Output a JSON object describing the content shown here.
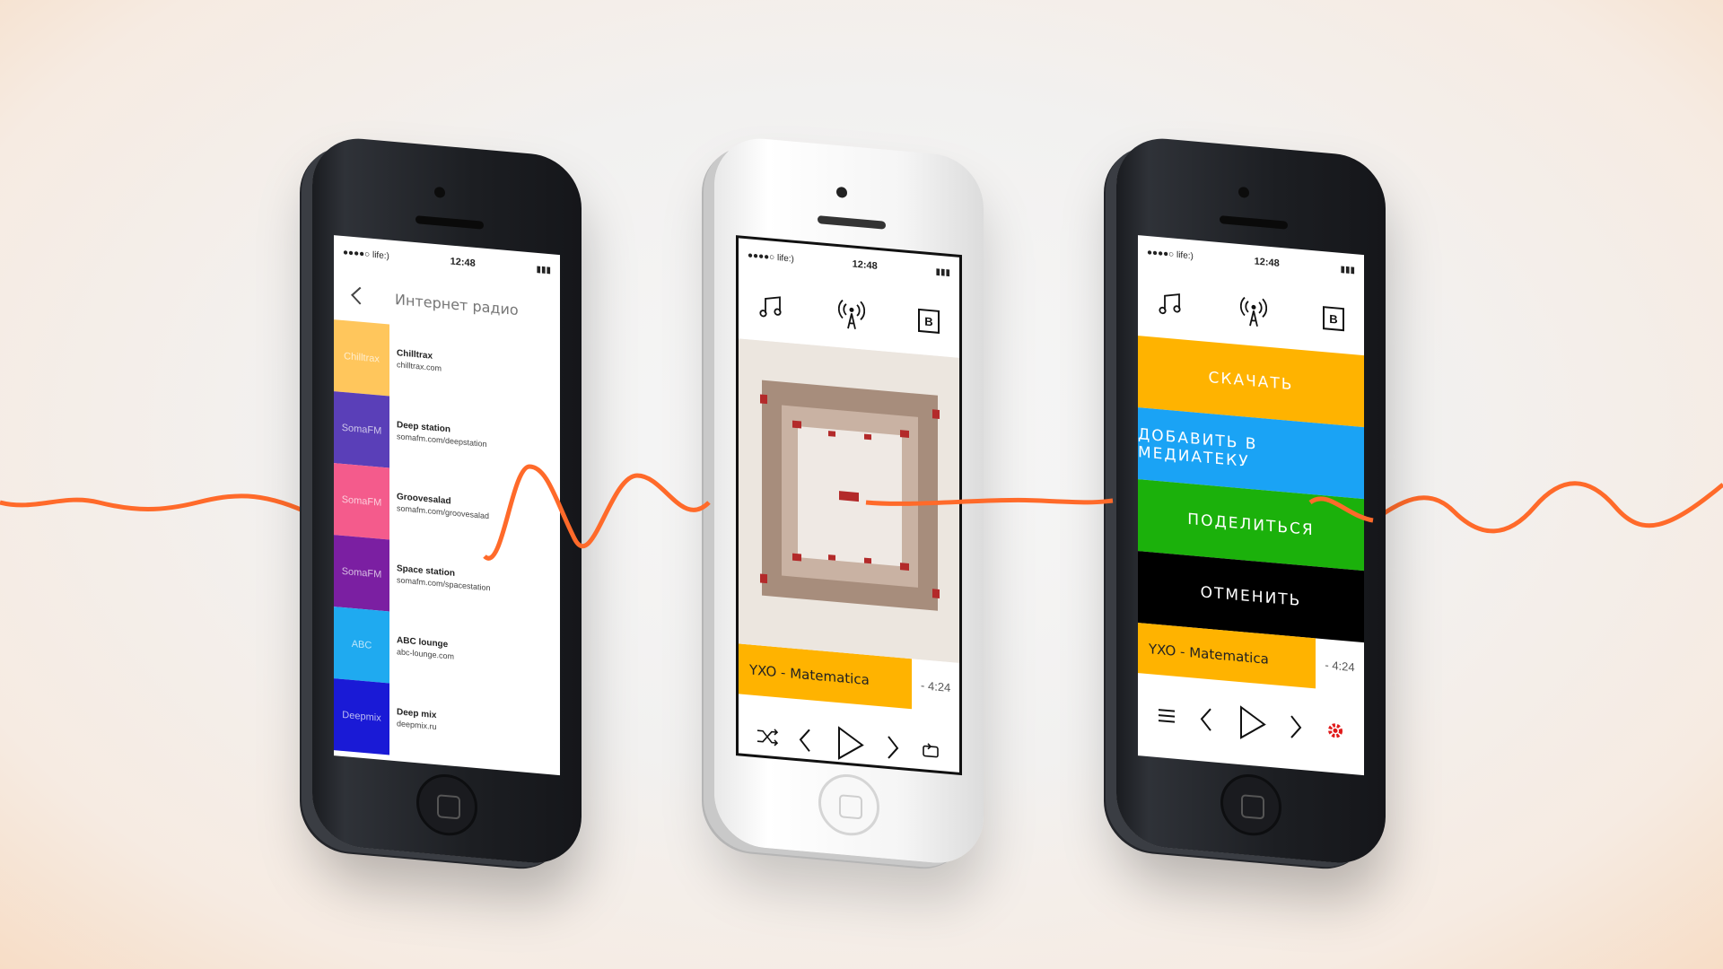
{
  "status_bar": {
    "carrier": "●●●●○ life:)",
    "time": "12:48"
  },
  "radio_list": {
    "title": "Интернет радио",
    "stations": [
      {
        "tile": "Chilltrax",
        "name": "Chilltrax",
        "url": "chilltrax.com",
        "color": "#ffc65c"
      },
      {
        "tile": "SomaFM",
        "name": "Deep station",
        "url": "somafm.com/deepstation",
        "color": "#5a3fb8"
      },
      {
        "tile": "SomaFM",
        "name": "Groovesalad",
        "url": "somafm.com/groovesalad",
        "color": "#f45b8c"
      },
      {
        "tile": "SomaFM",
        "name": "Space station",
        "url": "somafm.com/spacestation",
        "color": "#7b1fa2"
      },
      {
        "tile": "ABC",
        "name": "ABC lounge",
        "url": "abc-lounge.com",
        "color": "#1faaf0"
      },
      {
        "tile": "Deepmix",
        "name": "Deep mix",
        "url": "deepmix.ru",
        "color": "#1a1ad6"
      }
    ]
  },
  "player": {
    "b_icon_label": "B",
    "now_playing": "YXO - Matematica",
    "time_remaining": "- 4:24"
  },
  "actions": [
    {
      "label": "СКАЧАТЬ",
      "color": "#ffb300"
    },
    {
      "label": "ДОБАВИТЬ В МЕДИАТЕКУ",
      "color": "#1aa3f5"
    },
    {
      "label": "ПОДЕЛИТЬСЯ",
      "color": "#1bb10b"
    },
    {
      "label": "ОТМЕНИТЬ",
      "color": "#000000"
    }
  ],
  "colors": {
    "accent": "#ff5a1f",
    "player_bar": "#ffb300",
    "settings_gear": "#e11a1a"
  }
}
